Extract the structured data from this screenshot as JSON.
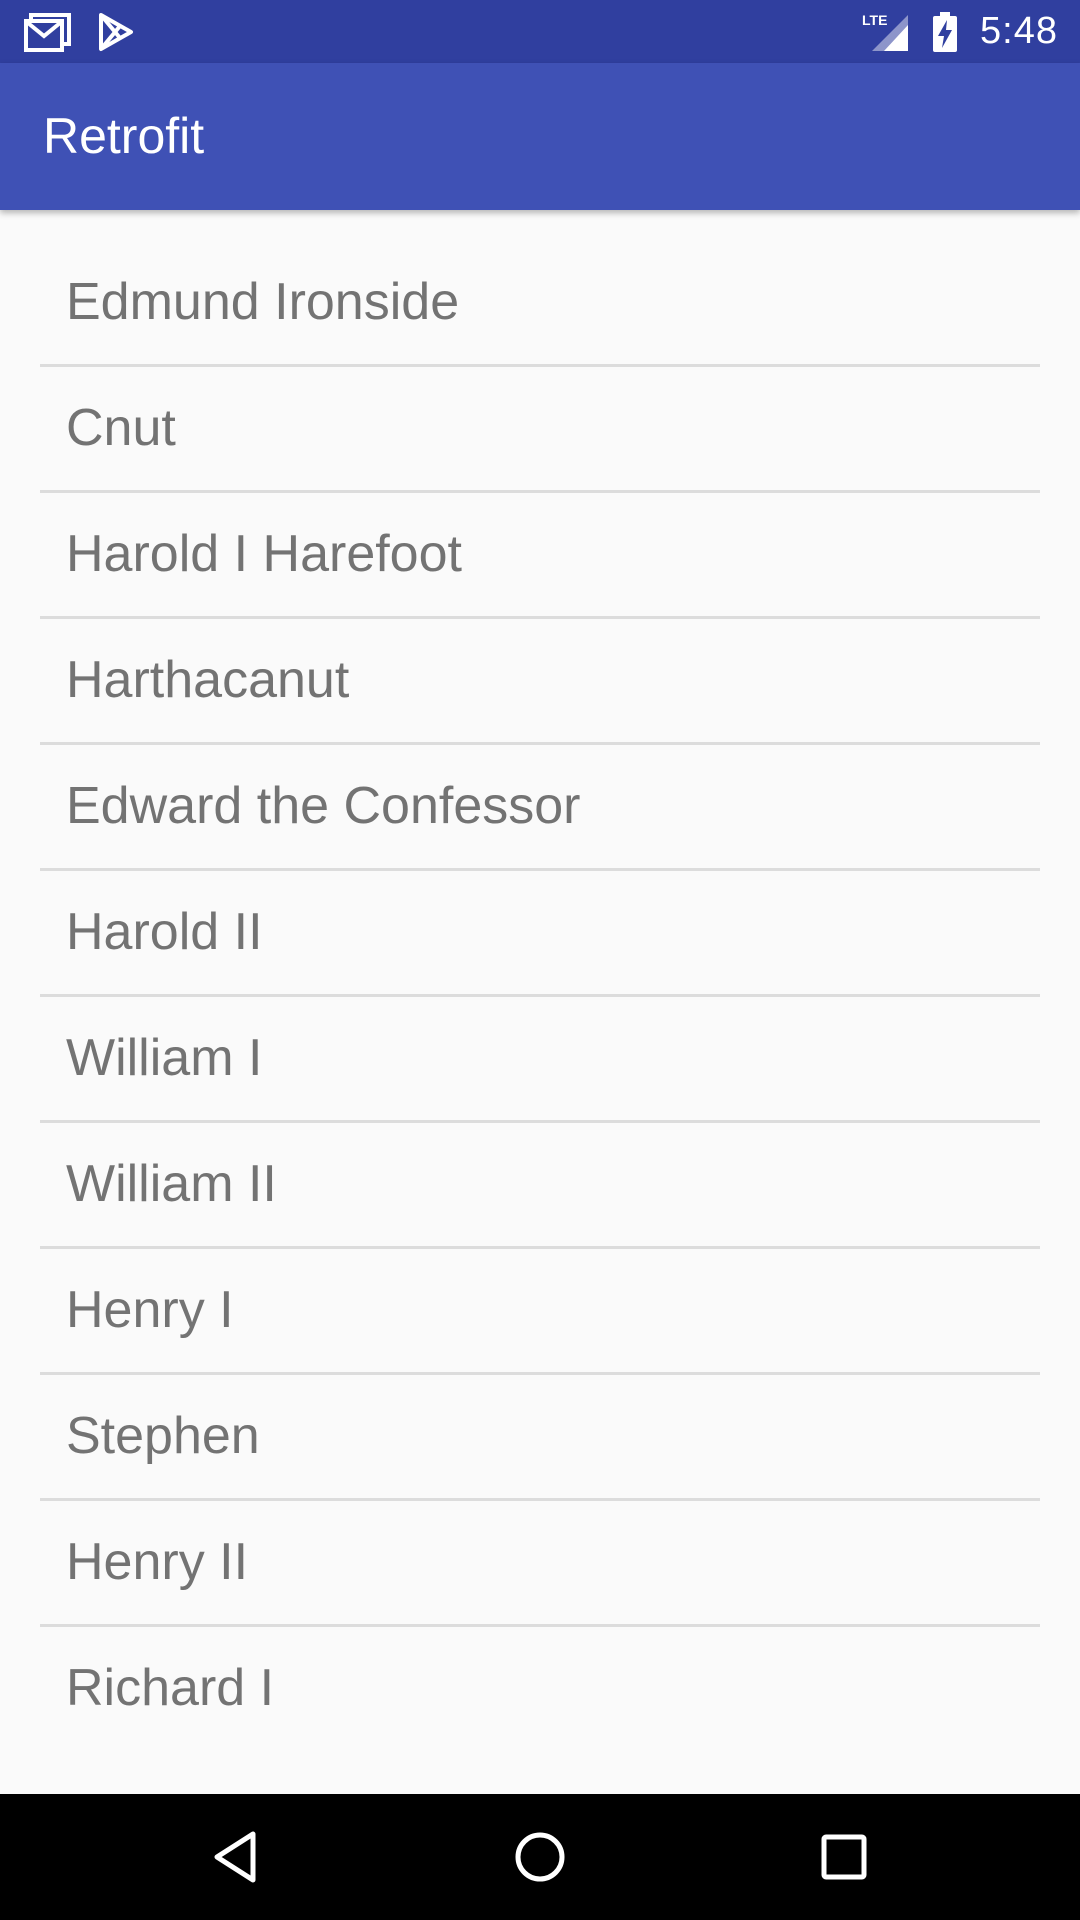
{
  "status_bar": {
    "time": "5:48",
    "network_label": "LTE",
    "icons": [
      "gmail-icon",
      "play-store-icon",
      "lte-signal-icon",
      "battery-charging-icon"
    ]
  },
  "app_bar": {
    "title": "Retrofit"
  },
  "list": {
    "items": [
      {
        "label": "Edmund Ironside"
      },
      {
        "label": "Cnut"
      },
      {
        "label": "Harold I Harefoot"
      },
      {
        "label": "Harthacanut"
      },
      {
        "label": "Edward the Confessor"
      },
      {
        "label": "Harold II"
      },
      {
        "label": "William I"
      },
      {
        "label": "William II"
      },
      {
        "label": "Henry I"
      },
      {
        "label": "Stephen"
      },
      {
        "label": "Henry II"
      },
      {
        "label": "Richard I"
      }
    ]
  },
  "nav_bar": {
    "buttons": [
      "back-icon",
      "home-icon",
      "recents-icon"
    ]
  },
  "colors": {
    "status_bar": "#303f9f",
    "app_bar": "#3f51b5",
    "background": "#fafafa",
    "item_text": "#737373",
    "divider": "#dcdcdc"
  }
}
